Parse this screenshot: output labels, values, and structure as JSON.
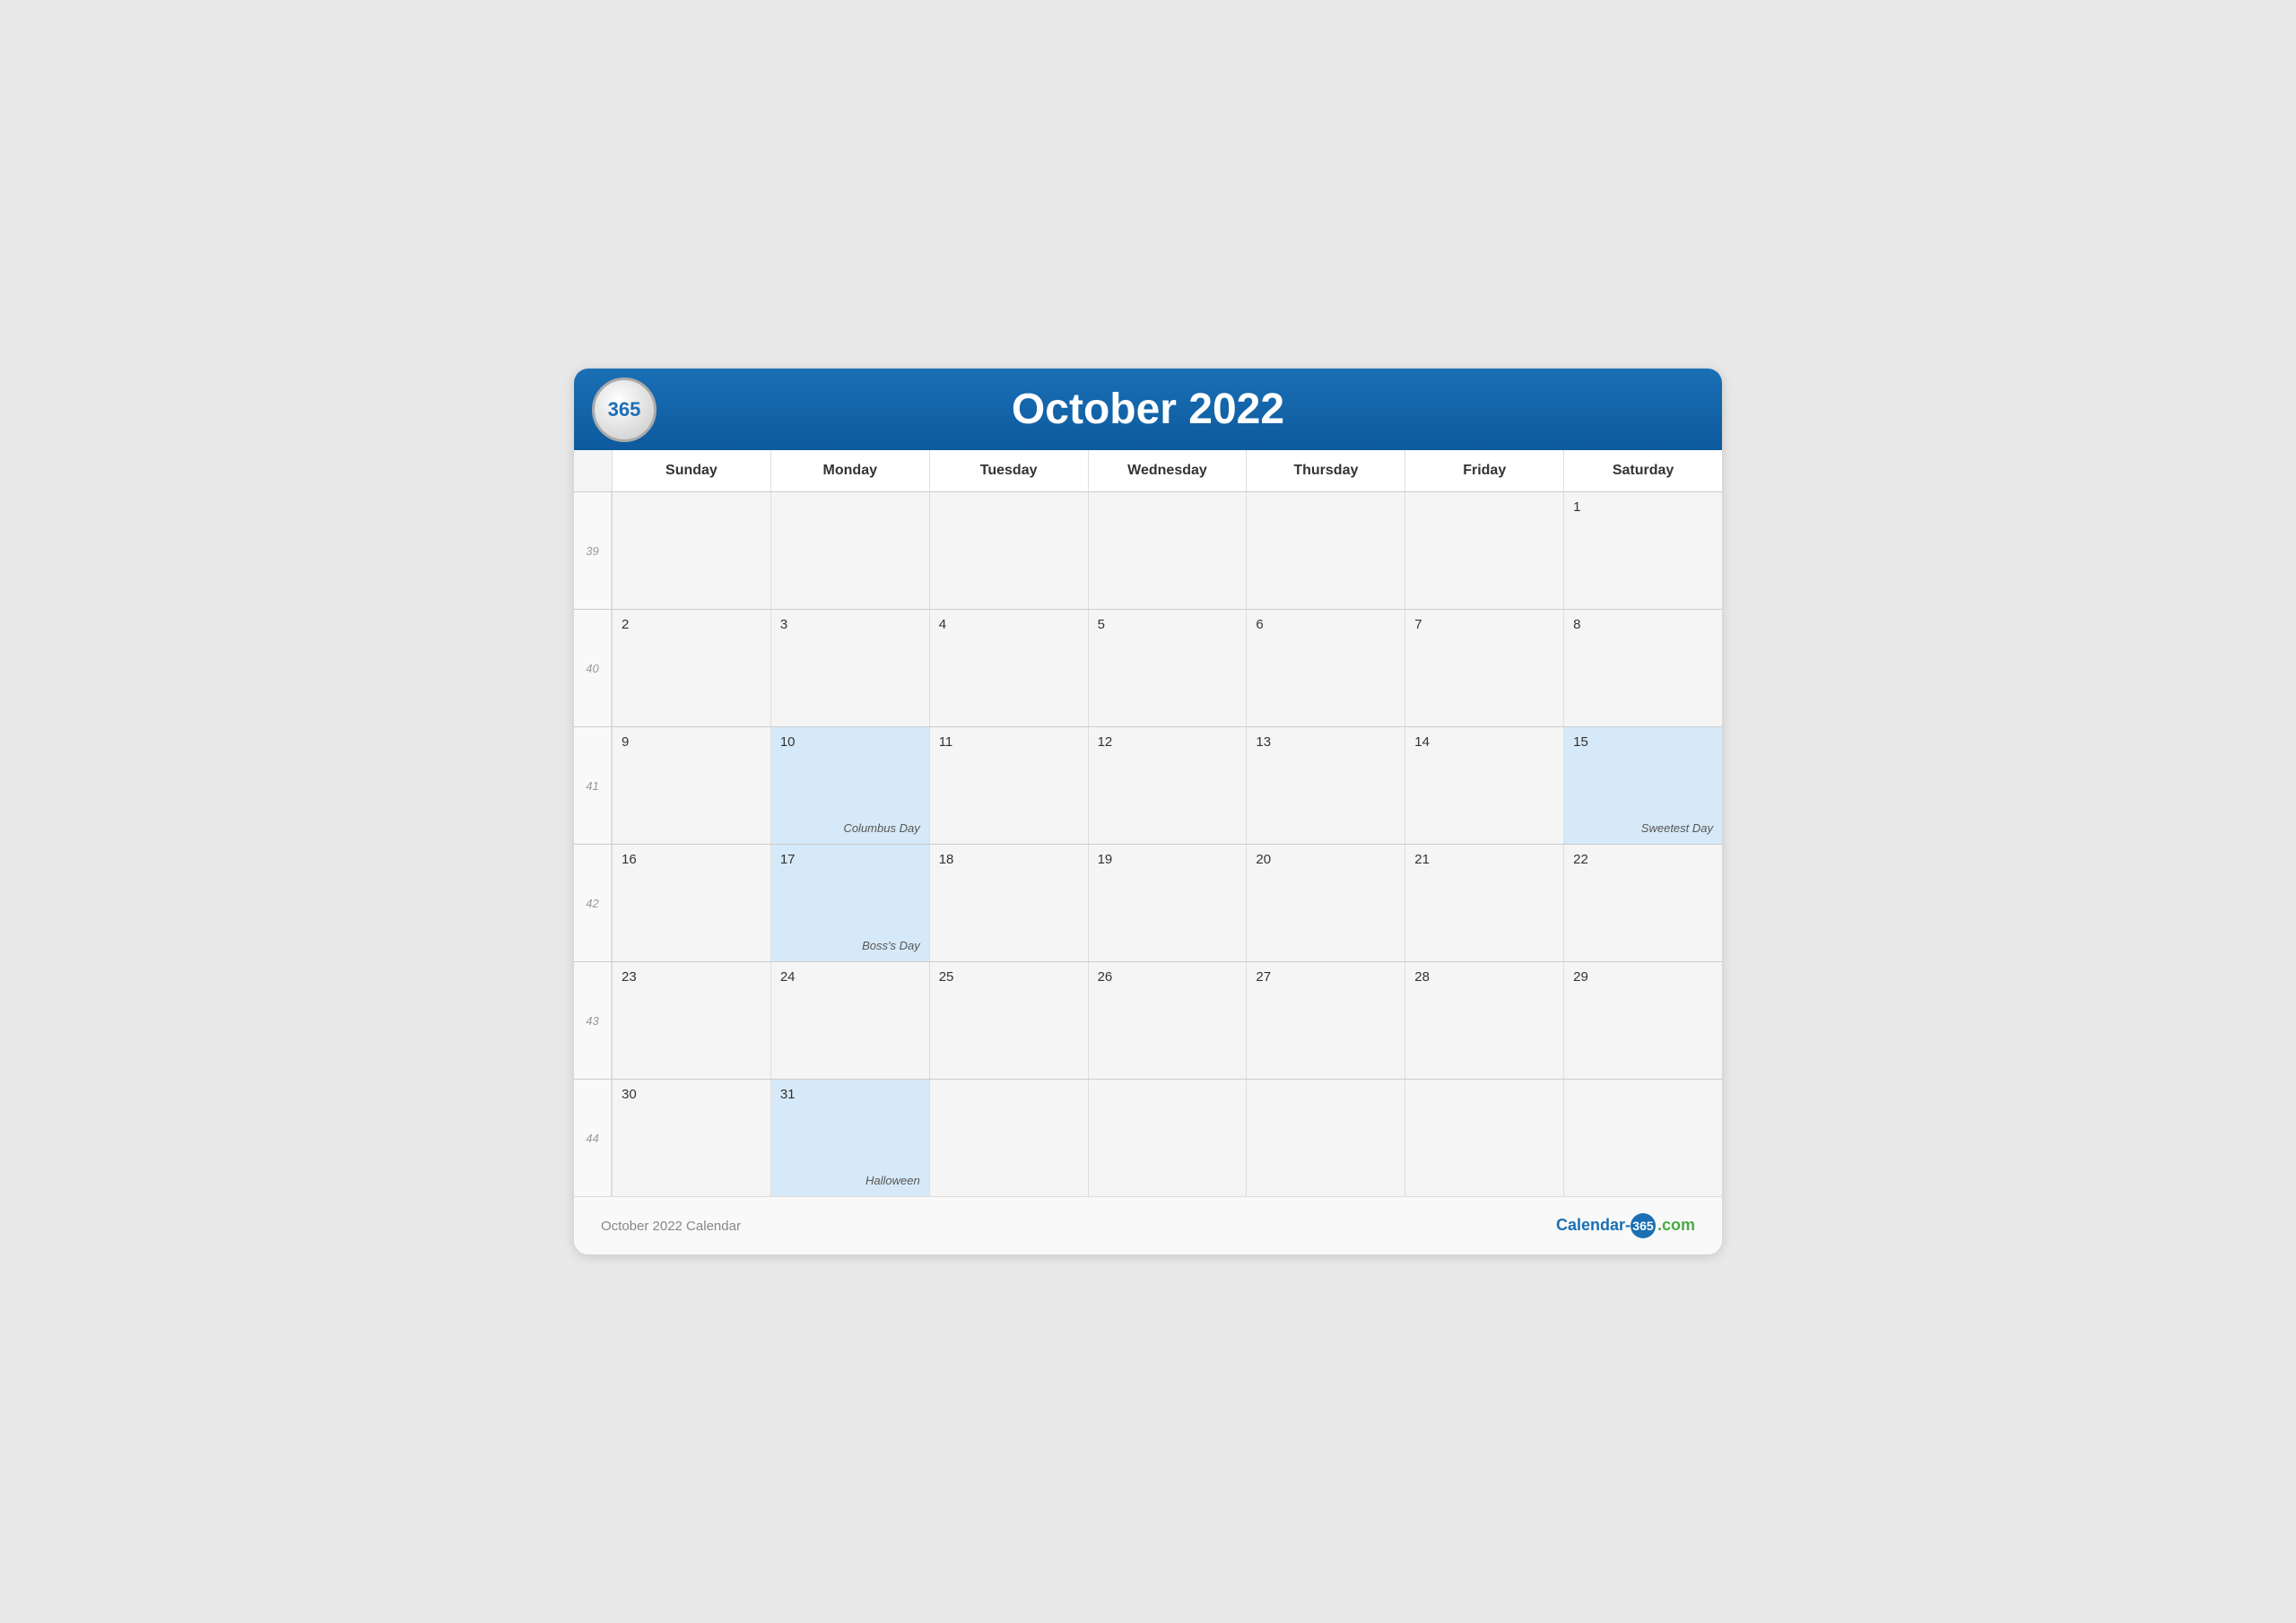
{
  "header": {
    "logo": "365",
    "title": "October 2022"
  },
  "days_of_week": [
    "Sunday",
    "Monday",
    "Tuesday",
    "Wednesday",
    "Thursday",
    "Friday",
    "Saturday"
  ],
  "weeks": [
    {
      "week_num": "39",
      "days": [
        {
          "date": "",
          "label": "",
          "month": "other",
          "highlight": false
        },
        {
          "date": "",
          "label": "",
          "month": "other",
          "highlight": false
        },
        {
          "date": "",
          "label": "",
          "month": "other",
          "highlight": false
        },
        {
          "date": "",
          "label": "",
          "month": "other",
          "highlight": false
        },
        {
          "date": "",
          "label": "",
          "month": "other",
          "highlight": false
        },
        {
          "date": "",
          "label": "",
          "month": "other",
          "highlight": false
        },
        {
          "date": "1",
          "label": "",
          "month": "current",
          "highlight": false
        }
      ]
    },
    {
      "week_num": "40",
      "days": [
        {
          "date": "2",
          "label": "",
          "month": "current",
          "highlight": false
        },
        {
          "date": "3",
          "label": "",
          "month": "current",
          "highlight": false
        },
        {
          "date": "4",
          "label": "",
          "month": "current",
          "highlight": false
        },
        {
          "date": "5",
          "label": "",
          "month": "current",
          "highlight": false
        },
        {
          "date": "6",
          "label": "",
          "month": "current",
          "highlight": false
        },
        {
          "date": "7",
          "label": "",
          "month": "current",
          "highlight": false
        },
        {
          "date": "8",
          "label": "",
          "month": "current",
          "highlight": false
        }
      ]
    },
    {
      "week_num": "41",
      "days": [
        {
          "date": "9",
          "label": "",
          "month": "current",
          "highlight": false
        },
        {
          "date": "10",
          "label": "Columbus Day",
          "month": "current",
          "highlight": true
        },
        {
          "date": "11",
          "label": "",
          "month": "current",
          "highlight": false
        },
        {
          "date": "12",
          "label": "",
          "month": "current",
          "highlight": false
        },
        {
          "date": "13",
          "label": "",
          "month": "current",
          "highlight": false
        },
        {
          "date": "14",
          "label": "",
          "month": "current",
          "highlight": false
        },
        {
          "date": "15",
          "label": "Sweetest Day",
          "month": "current",
          "highlight": true
        }
      ]
    },
    {
      "week_num": "42",
      "days": [
        {
          "date": "16",
          "label": "",
          "month": "current",
          "highlight": false
        },
        {
          "date": "17",
          "label": "Boss's Day",
          "month": "current",
          "highlight": true
        },
        {
          "date": "18",
          "label": "",
          "month": "current",
          "highlight": false
        },
        {
          "date": "19",
          "label": "",
          "month": "current",
          "highlight": false
        },
        {
          "date": "20",
          "label": "",
          "month": "current",
          "highlight": false
        },
        {
          "date": "21",
          "label": "",
          "month": "current",
          "highlight": false
        },
        {
          "date": "22",
          "label": "",
          "month": "current",
          "highlight": false
        }
      ]
    },
    {
      "week_num": "43",
      "days": [
        {
          "date": "23",
          "label": "",
          "month": "current",
          "highlight": false
        },
        {
          "date": "24",
          "label": "",
          "month": "current",
          "highlight": false
        },
        {
          "date": "25",
          "label": "",
          "month": "current",
          "highlight": false
        },
        {
          "date": "26",
          "label": "",
          "month": "current",
          "highlight": false
        },
        {
          "date": "27",
          "label": "",
          "month": "current",
          "highlight": false
        },
        {
          "date": "28",
          "label": "",
          "month": "current",
          "highlight": false
        },
        {
          "date": "29",
          "label": "",
          "month": "current",
          "highlight": false
        }
      ]
    },
    {
      "week_num": "44",
      "days": [
        {
          "date": "30",
          "label": "",
          "month": "current",
          "highlight": false
        },
        {
          "date": "31",
          "label": "Halloween",
          "month": "current",
          "highlight": true
        },
        {
          "date": "",
          "label": "",
          "month": "other",
          "highlight": false
        },
        {
          "date": "",
          "label": "",
          "month": "other",
          "highlight": false
        },
        {
          "date": "",
          "label": "",
          "month": "other",
          "highlight": false
        },
        {
          "date": "",
          "label": "",
          "month": "other",
          "highlight": false
        },
        {
          "date": "",
          "label": "",
          "month": "other",
          "highlight": false
        }
      ]
    }
  ],
  "footer": {
    "left": "October 2022 Calendar",
    "right_prefix": "Calendar-",
    "right_num": "365",
    "right_suffix": ".com"
  },
  "colors": {
    "header_gradient_start": "#1a6fb5",
    "header_gradient_end": "#0d5a9e",
    "highlight_bg": "#d6e9f8",
    "cell_bg": "#f5f5f5"
  }
}
